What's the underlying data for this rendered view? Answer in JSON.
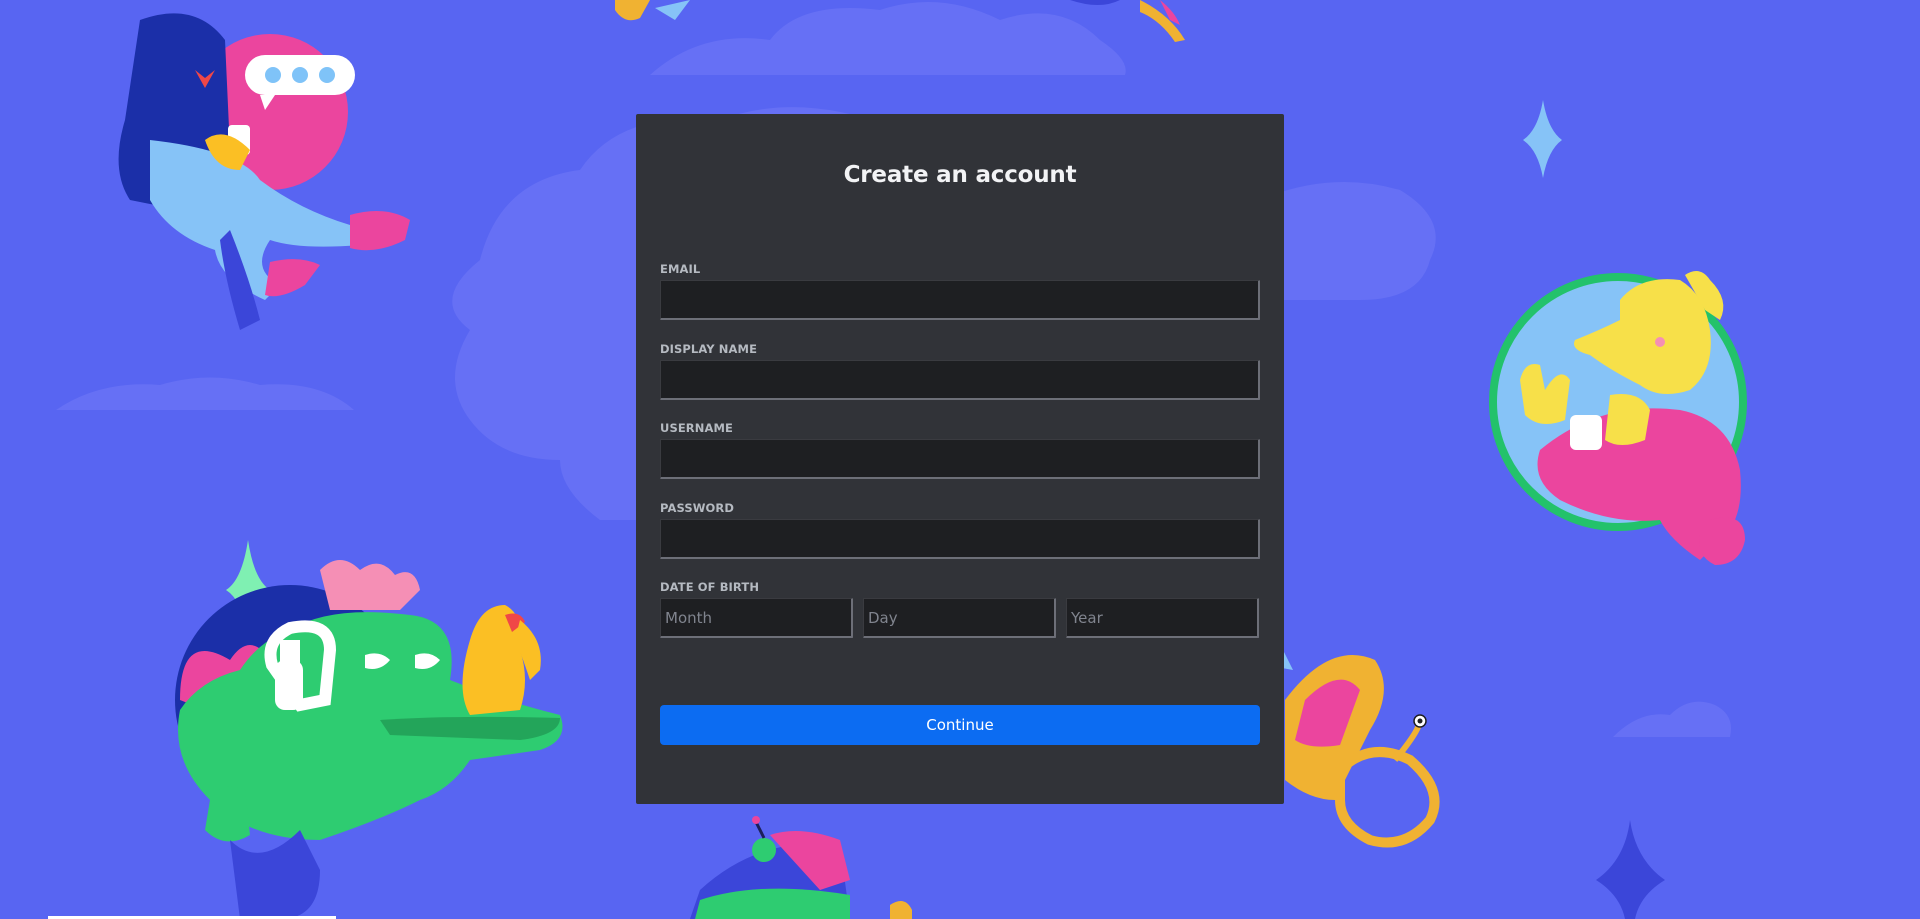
{
  "form": {
    "title": "Create an account",
    "fields": {
      "email": {
        "label": "EMAIL",
        "value": ""
      },
      "display_name": {
        "label": "DISPLAY NAME",
        "value": ""
      },
      "username": {
        "label": "USERNAME",
        "value": ""
      },
      "password": {
        "label": "PASSWORD",
        "value": ""
      }
    },
    "dob": {
      "label": "DATE OF BIRTH",
      "month_placeholder": "Month",
      "day_placeholder": "Day",
      "year_placeholder": "Year"
    },
    "continue_label": "Continue"
  },
  "colors": {
    "background": "#5865f2",
    "card": "#313338",
    "input": "#1e1f22",
    "button": "#0c6cf2"
  },
  "icons": {
    "cursor": "cursor-icon"
  }
}
